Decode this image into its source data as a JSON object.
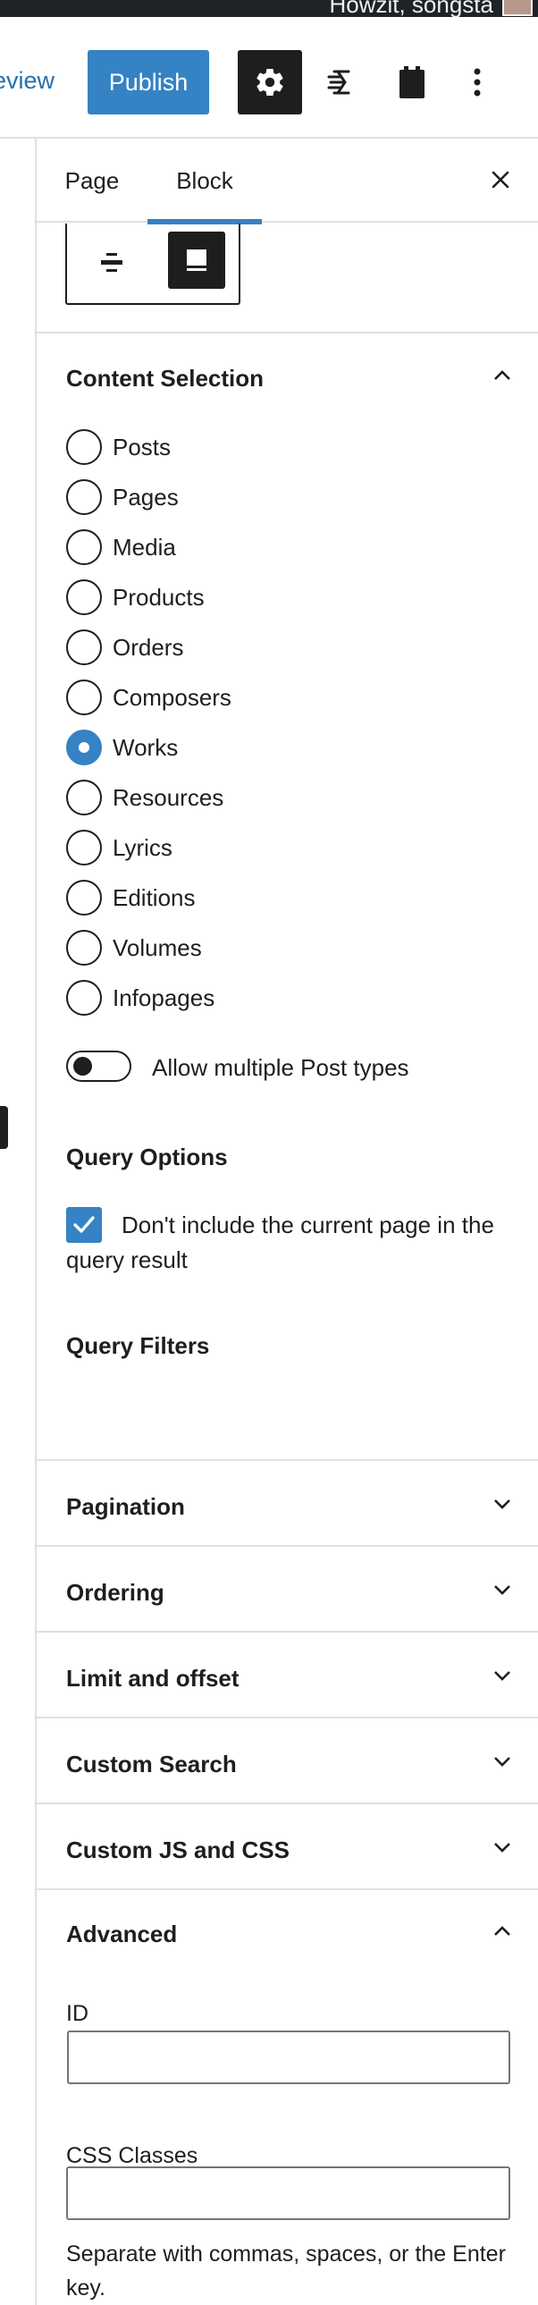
{
  "admin_bar": {
    "greeting": "Howzit, songsta"
  },
  "toolbar": {
    "preview_label": "eview",
    "publish_label": "Publish"
  },
  "sidebar": {
    "tabs": [
      {
        "label": "Page"
      },
      {
        "label": "Block"
      }
    ],
    "content_selection": {
      "title": "Content Selection",
      "options": [
        {
          "label": "Posts",
          "checked": false
        },
        {
          "label": "Pages",
          "checked": false
        },
        {
          "label": "Media",
          "checked": false
        },
        {
          "label": "Products",
          "checked": false
        },
        {
          "label": "Orders",
          "checked": false
        },
        {
          "label": "Composers",
          "checked": false
        },
        {
          "label": "Works",
          "checked": true
        },
        {
          "label": "Resources",
          "checked": false
        },
        {
          "label": "Lyrics",
          "checked": false
        },
        {
          "label": "Editions",
          "checked": false
        },
        {
          "label": "Volumes",
          "checked": false
        },
        {
          "label": "Infopages",
          "checked": false
        }
      ],
      "toggle_label": "Allow multiple Post types",
      "toggle_on": false
    },
    "query_options": {
      "title": "Query Options",
      "checkbox_label": "Don't include the current page in the query result",
      "checked": true
    },
    "query_filters": {
      "title": "Query Filters"
    },
    "panels": [
      {
        "title": "Pagination"
      },
      {
        "title": "Ordering"
      },
      {
        "title": "Limit and offset"
      },
      {
        "title": "Custom Search"
      },
      {
        "title": "Custom JS and CSS"
      }
    ],
    "advanced": {
      "title": "Advanced",
      "id_label": "ID",
      "id_value": "",
      "css_label": "CSS Classes",
      "css_value": "",
      "help_text": "Separate with commas, spaces, or the Enter key."
    }
  },
  "colors": {
    "accent": "#3582c4",
    "dark": "#1e1e1e",
    "admin_bar": "#1d2327",
    "divider": "#e0e0e0"
  }
}
